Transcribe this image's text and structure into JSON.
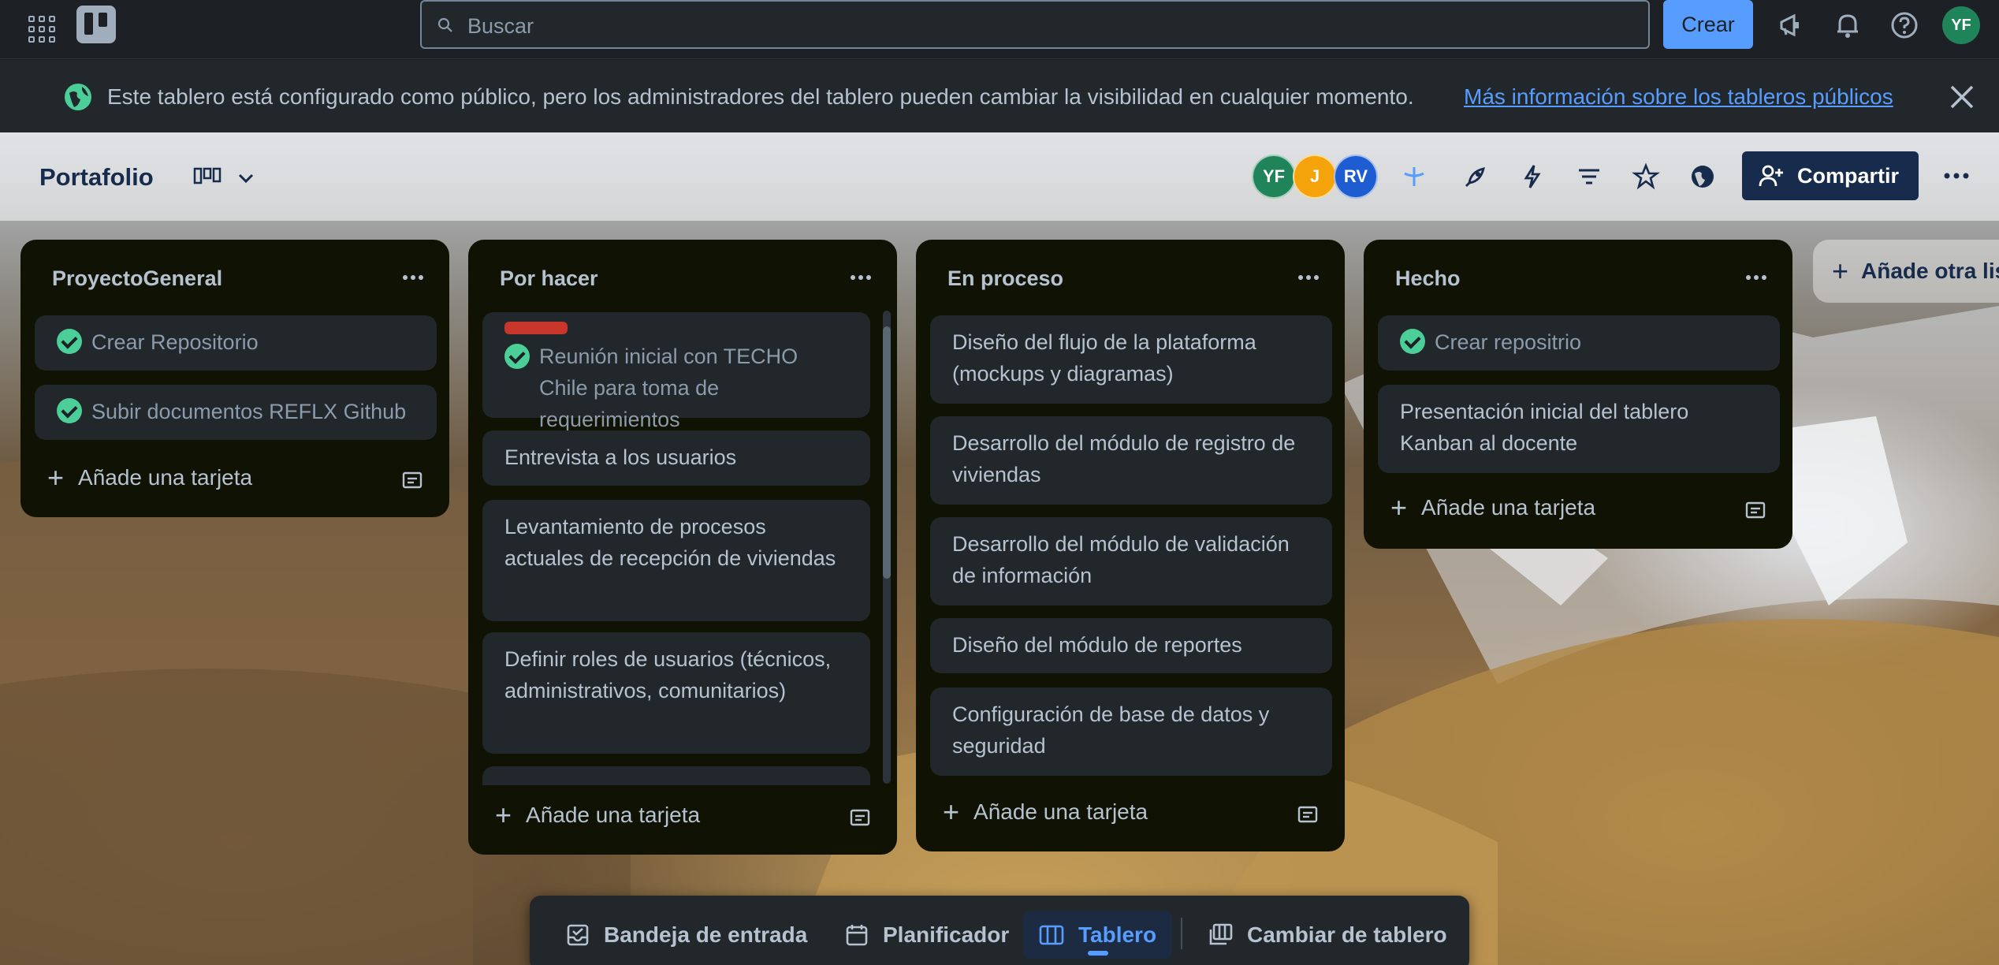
{
  "topnav": {
    "search_placeholder": "Buscar",
    "create_label": "Crear",
    "user_initials": "YF"
  },
  "banner": {
    "text": "Este tablero está configurado como público, pero los administradores del tablero pueden cambiar la visibilidad en cualquier momento.",
    "link": "Más información sobre los tableros públicos"
  },
  "board": {
    "title": "Portafolio",
    "members": [
      {
        "initials": "YF",
        "color": "#1f845a"
      },
      {
        "initials": "J",
        "color": "#f5a30a"
      },
      {
        "initials": "RV",
        "color": "#1d5cd1"
      }
    ],
    "share_label": "Compartir",
    "add_list_label": "Añade otra lista"
  },
  "lists": [
    {
      "title": "ProyectoGeneral",
      "cards": [
        {
          "text": "Crear Repositorio",
          "done": true
        },
        {
          "text": "Subir documentos REFLX Github",
          "done": true
        }
      ],
      "add_card": "Añade una tarjeta"
    },
    {
      "title": "Por hacer",
      "cards": [
        {
          "text": "Reunión inicial con TECHO Chile para toma de requerimientos",
          "done": true,
          "label": "red"
        },
        {
          "text": "Entrevista a los usuarios"
        },
        {
          "text": "Levantamiento de procesos actuales de recepción de viviendas"
        },
        {
          "text": "Definir roles de usuarios (técnicos, administrativos, comunitarios)"
        }
      ],
      "add_card": "Añade una tarjeta"
    },
    {
      "title": "En proceso",
      "cards": [
        {
          "text": "Diseño del flujo de la plataforma (mockups y diagramas)"
        },
        {
          "text": "Desarrollo del módulo de registro de viviendas"
        },
        {
          "text": "Desarrollo del módulo de validación de información"
        },
        {
          "text": "Diseño del módulo de reportes"
        },
        {
          "text": "Configuración de base de datos y seguridad"
        }
      ],
      "add_card": "Añade una tarjeta"
    },
    {
      "title": "Hecho",
      "cards": [
        {
          "text": "Crear repositrio",
          "done": true
        },
        {
          "text": "Presentación inicial del tablero Kanban al docente"
        }
      ],
      "add_card": "Añade una tarjeta"
    }
  ],
  "switcher": {
    "inbox": "Bandeja de entrada",
    "planner": "Planificador",
    "board": "Tablero",
    "switch_board": "Cambiar de tablero"
  },
  "colors": {
    "accent": "#579dff",
    "check": "#4bce97",
    "list_bg": "#101204"
  }
}
